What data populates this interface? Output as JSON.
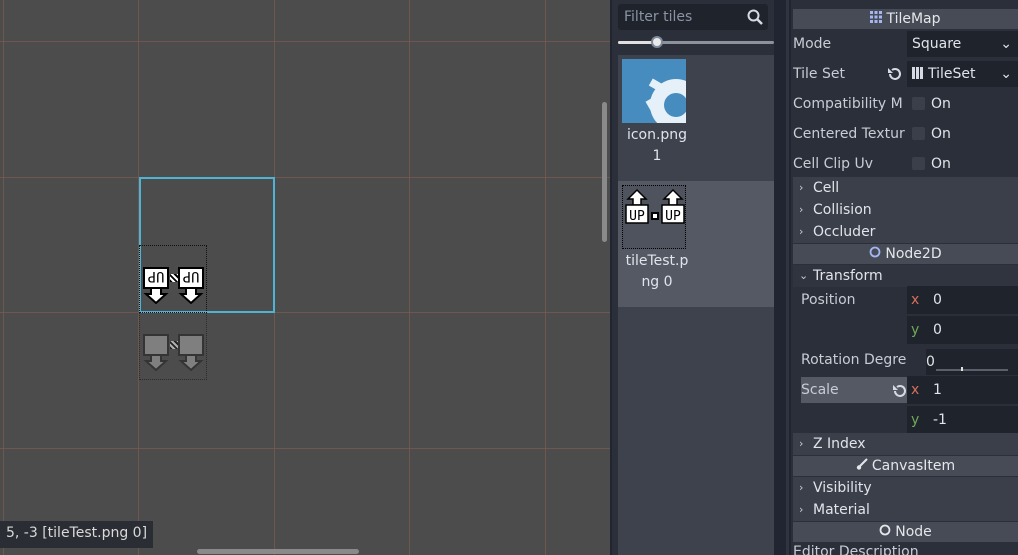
{
  "viewport": {
    "status": "5, -3 [tileTest.png 0]"
  },
  "palette": {
    "filter_placeholder": "Filter tiles",
    "zoom_level": 0.25,
    "tiles": [
      {
        "label": "icon.png 1",
        "icon": "godot-icon"
      },
      {
        "label": "tileTest.png 0",
        "icon": "up-arrows-tile"
      }
    ]
  },
  "inspector": {
    "tilemap_header": "TileMap",
    "mode_label": "Mode",
    "mode_value": "Square",
    "tileset_label": "Tile Set",
    "tileset_value": "TileSet",
    "compat_label": "Compatibility M",
    "compat_value": "On",
    "centered_label": "Centered Textur",
    "centered_value": "On",
    "clip_label": "Cell Clip Uv",
    "clip_value": "On",
    "group_cell": "Cell",
    "group_collision": "Collision",
    "group_occluder": "Occluder",
    "node2d_header": "Node2D",
    "group_transform": "Transform",
    "position_label": "Position",
    "position_x": "0",
    "position_y": "0",
    "rotation_label": "Rotation Degre",
    "rotation_value": "0",
    "scale_label": "Scale",
    "scale_x": "1",
    "scale_y": "-1",
    "axis_x": "x",
    "axis_y": "y",
    "group_zindex": "Z Index",
    "canvasitem_header": "CanvasItem",
    "group_visibility": "Visibility",
    "group_material": "Material",
    "node_header": "Node",
    "editor_description": "Editor Description"
  },
  "colors": {
    "viewport_bg": "#4c4c4c",
    "grid": "#7a5b4d",
    "cell_highlight": "#4fb3d6",
    "panel_bg": "#2b2f39",
    "header_bg": "#464b56"
  }
}
